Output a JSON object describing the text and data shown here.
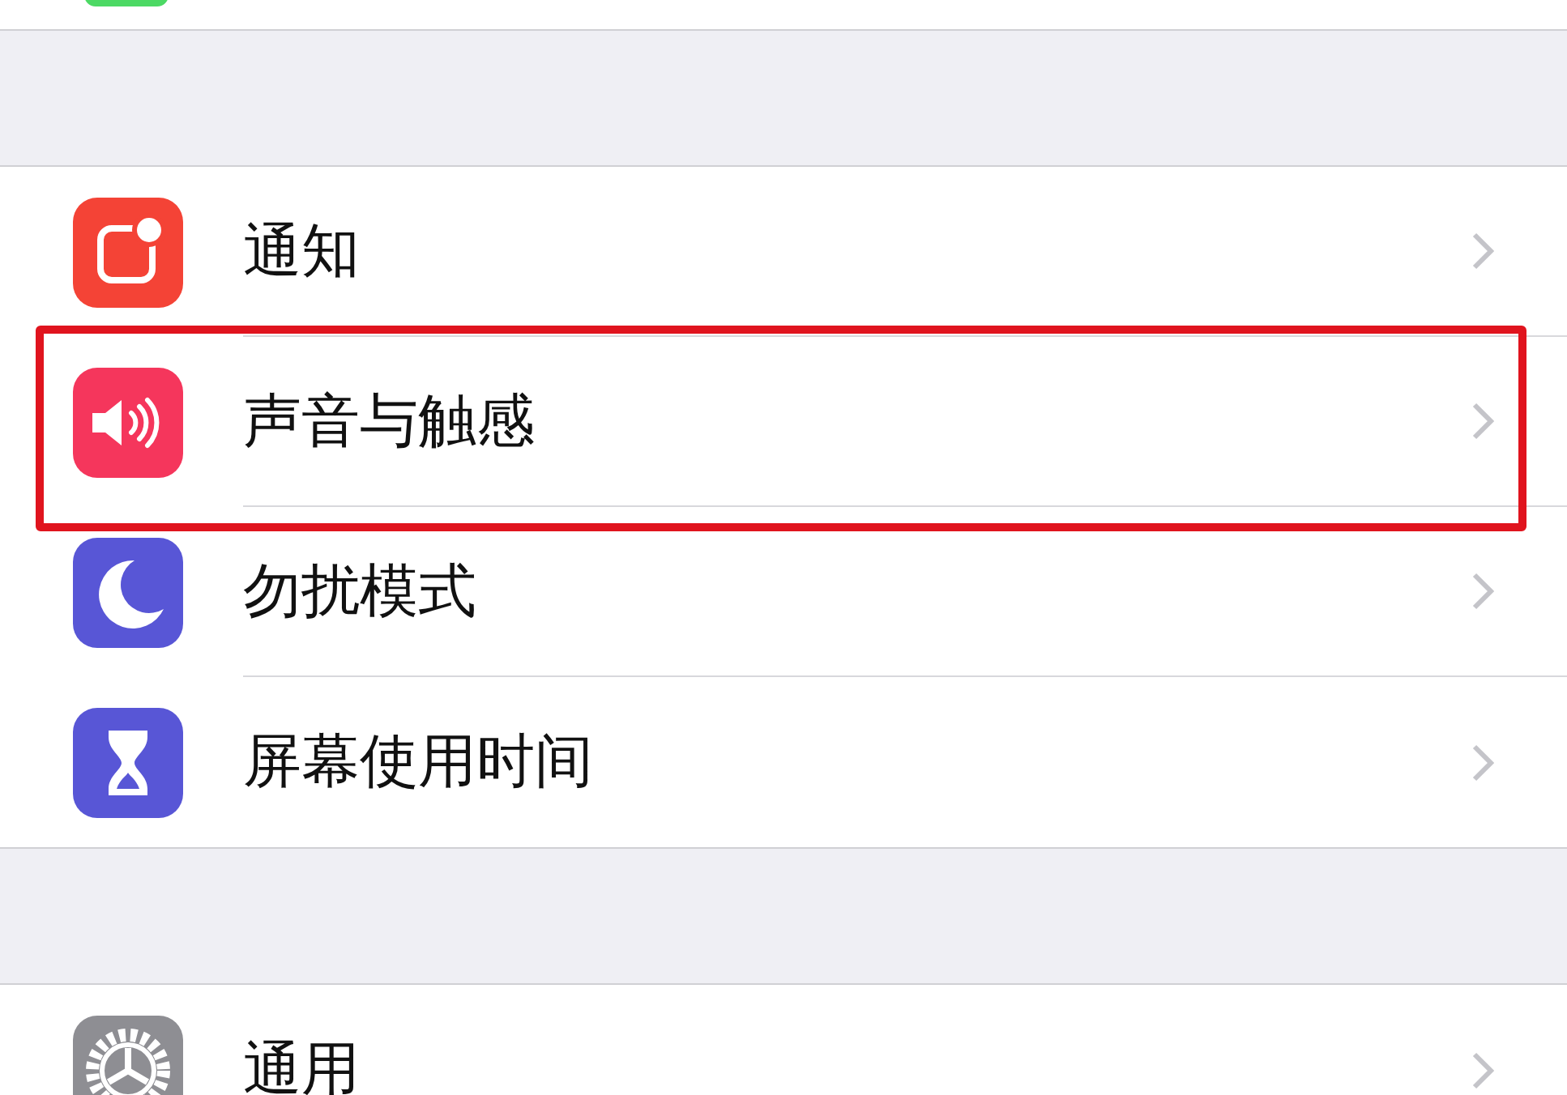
{
  "sections": [
    {
      "items": [
        {
          "label": "通知",
          "kind": "notifications",
          "highlighted": false
        },
        {
          "label": "声音与触感",
          "kind": "sound",
          "highlighted": true
        },
        {
          "label": "勿扰模式",
          "kind": "moon",
          "highlighted": false
        },
        {
          "label": "屏幕使用时间",
          "kind": "hourglass",
          "highlighted": false
        }
      ]
    },
    {
      "items": [
        {
          "label": "通用",
          "kind": "gear",
          "highlighted": false
        }
      ]
    }
  ]
}
